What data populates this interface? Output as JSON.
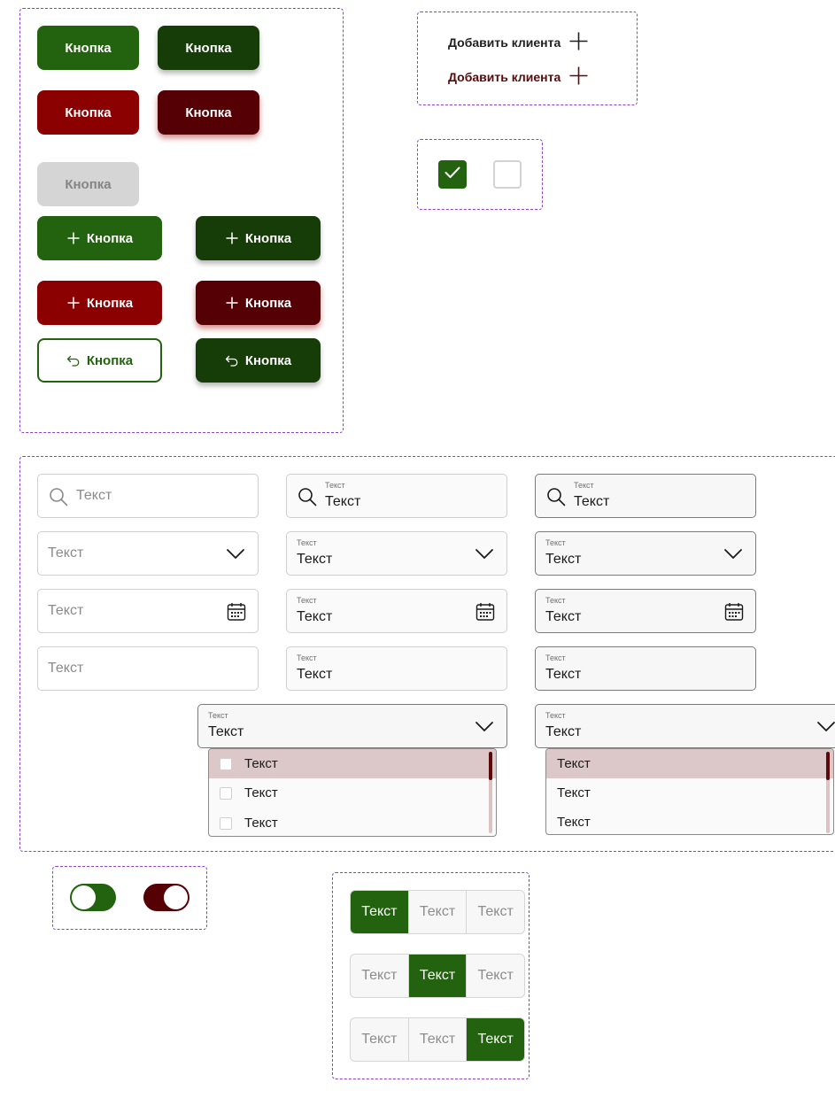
{
  "buttons": {
    "primary": "Кнопка",
    "primary_hover": "Кнопка",
    "danger": "Кнопка",
    "danger_hover": "Кнопка",
    "disabled": "Кнопка",
    "add_primary": "Кнопка",
    "add_primary_hover": "Кнопка",
    "add_danger": "Кнопка",
    "add_danger_hover": "Кнопка",
    "back_outline": "Кнопка",
    "back_filled": "Кнопка"
  },
  "links": {
    "add_client_default": "Добавить клиента",
    "add_client_hover": "Добавить клиента"
  },
  "checkboxes": {
    "checked": true,
    "unchecked": false
  },
  "fields": {
    "search": [
      {
        "placeholder": "Текст"
      },
      {
        "label": "Текст",
        "value": "Текст"
      },
      {
        "label": "Текст",
        "value": "Текст"
      }
    ],
    "select": [
      {
        "placeholder": "Текст"
      },
      {
        "label": "Текст",
        "value": "Текст"
      },
      {
        "label": "Текст",
        "value": "Текст"
      }
    ],
    "date": [
      {
        "placeholder": "Текст"
      },
      {
        "label": "Текст",
        "value": "Текст"
      },
      {
        "label": "Текст",
        "value": "Текст"
      }
    ],
    "text": [
      {
        "placeholder": "Текст"
      },
      {
        "label": "Текст",
        "value": "Текст"
      },
      {
        "label": "Текст",
        "value": "Текст"
      }
    ]
  },
  "dropdown_multi": {
    "label": "Текст",
    "value": "Текст",
    "options": [
      "Текст",
      "Текст",
      "Текст"
    ]
  },
  "dropdown_single": {
    "label": "Текст",
    "value": "Текст",
    "options": [
      "Текст",
      "Текст",
      "Текст"
    ]
  },
  "toggles": {
    "green_on": true,
    "red_on": true
  },
  "segments": [
    {
      "items": [
        "Текст",
        "Текст",
        "Текст"
      ],
      "active": 0
    },
    {
      "items": [
        "Текст",
        "Текст",
        "Текст"
      ],
      "active": 1
    },
    {
      "items": [
        "Текст",
        "Текст",
        "Текст"
      ],
      "active": 2
    }
  ],
  "colors": {
    "primary": "#23620f",
    "primary_dark": "#163c07",
    "danger": "#8b0000",
    "danger_dark": "#540004",
    "selection": "#dcc8c8",
    "frame": "#8a3fd8"
  }
}
